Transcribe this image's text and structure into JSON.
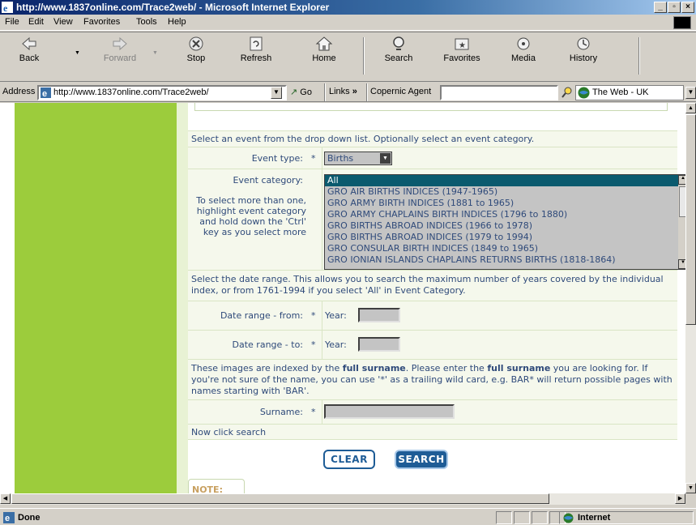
{
  "window": {
    "title": "http://www.1837online.com/Trace2web/ - Microsoft Internet Explorer"
  },
  "menu": [
    "File",
    "Edit",
    "View",
    "Favorites",
    "Tools",
    "Help"
  ],
  "toolbar": {
    "back": "Back",
    "forward": "Forward",
    "stop": "Stop",
    "refresh": "Refresh",
    "home": "Home",
    "search": "Search",
    "favorites": "Favorites",
    "media": "Media",
    "history": "History"
  },
  "address": {
    "label": "Address",
    "url": "http://www.1837online.com/Trace2web/",
    "go": "Go",
    "links": "Links",
    "links_chevron": "»",
    "links_item": "Copernic Agent",
    "web_label": "The Web - UK"
  },
  "form": {
    "intro": "Select an event from the drop down list. Optionally select an event category.",
    "event_type_label": "Event type:",
    "required_mark": "*",
    "event_type_value": "Births",
    "event_category_label": "Event category:",
    "category_help": "To select more than one, highlight event category and hold down the 'Ctrl' key as you select more",
    "categories": [
      "All",
      "GRO AIR BIRTHS INDICES (1947-1965)",
      "GRO ARMY BIRTH INDICES (1881 to 1965)",
      "GRO ARMY CHAPLAINS BIRTH INDICES (1796 to 1880)",
      "GRO BIRTHS ABROAD INDICES (1966 to 1978)",
      "GRO BIRTHS ABROAD INDICES (1979 to 1994)",
      "GRO CONSULAR BIRTH INDICES (1849 to 1965)",
      "GRO IONIAN ISLANDS CHAPLAINS RETURNS BIRTHS (1818-1864)"
    ],
    "date_intro": "Select the date range. This allows you to search the maximum number of years covered by the individual index, or from 1761-1994 if you select 'All' in Event Category.",
    "date_from_label": "Date range - from:",
    "date_to_label": "Date range - to:",
    "year_label": "Year:",
    "surname_intro_1": "These images are indexed by the ",
    "surname_intro_b1": "full surname",
    "surname_intro_2": ". Please enter the ",
    "surname_intro_b2": "full surname",
    "surname_intro_3": " you are looking for. If you're not sure of the name, you can use '*' as a trailing wild card, e.g. BAR* will return possible pages with names starting with 'BAR'.",
    "surname_label": "Surname:",
    "now_click": "Now click search",
    "clear_button": "CLEAR",
    "search_button": "SEARCH",
    "note": "NOTE:"
  },
  "status": {
    "text": "Done",
    "zone": "Internet"
  },
  "colors": {
    "sidebar_green": "#9ccc3c",
    "label_blue": "#2f4a7a",
    "button_blue": "#1e5c96",
    "row_bg": "#f5f8ec",
    "selected": "#0a5a6e"
  }
}
